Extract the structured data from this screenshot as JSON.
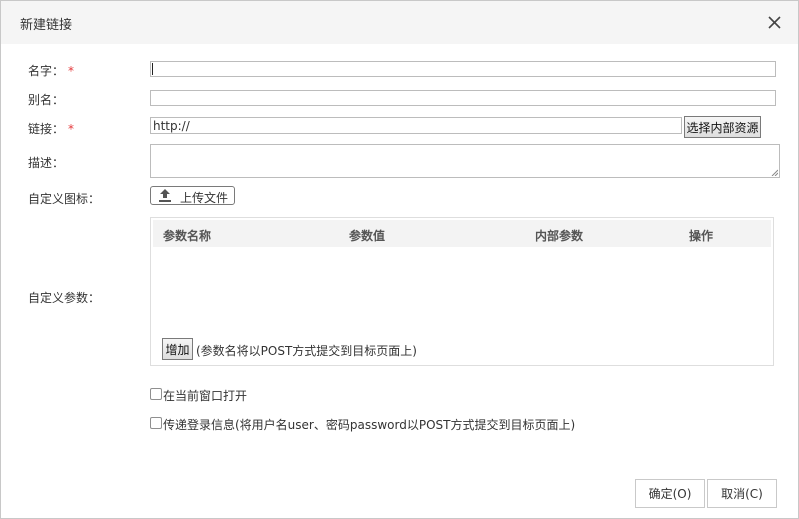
{
  "dialog": {
    "title": "新建链接",
    "close_icon": "close-icon"
  },
  "form": {
    "name": {
      "label": "名字：",
      "required": "*",
      "value": ""
    },
    "alias": {
      "label": "别名：",
      "value": ""
    },
    "link": {
      "label": "链接：",
      "required": "*",
      "value": "http://",
      "choose_button": "选择内部资源"
    },
    "description": {
      "label": "描述：",
      "value": ""
    },
    "icon": {
      "label": "自定义图标：",
      "upload_button": "上传文件",
      "upload_icon": "upload-icon"
    },
    "params": {
      "label": "自定义参数：",
      "columns": [
        "参数名称",
        "参数值",
        "内部参数",
        "操作"
      ],
      "rows": [],
      "add_button": "增加",
      "hint": "(参数名将以POST方式提交到目标页面上)"
    },
    "open_current_window": {
      "label": "在当前窗口打开",
      "checked": false
    },
    "pass_login": {
      "label": "传递登录信息(将用户名user、密码password以POST方式提交到目标页面上)",
      "checked": false
    }
  },
  "footer": {
    "ok_label": "确定(O)",
    "cancel_label": "取消(C)"
  },
  "colors": {
    "required": "#e4393c",
    "title_bar": "#f5f5f5",
    "table_header": "#f3f3f3"
  }
}
